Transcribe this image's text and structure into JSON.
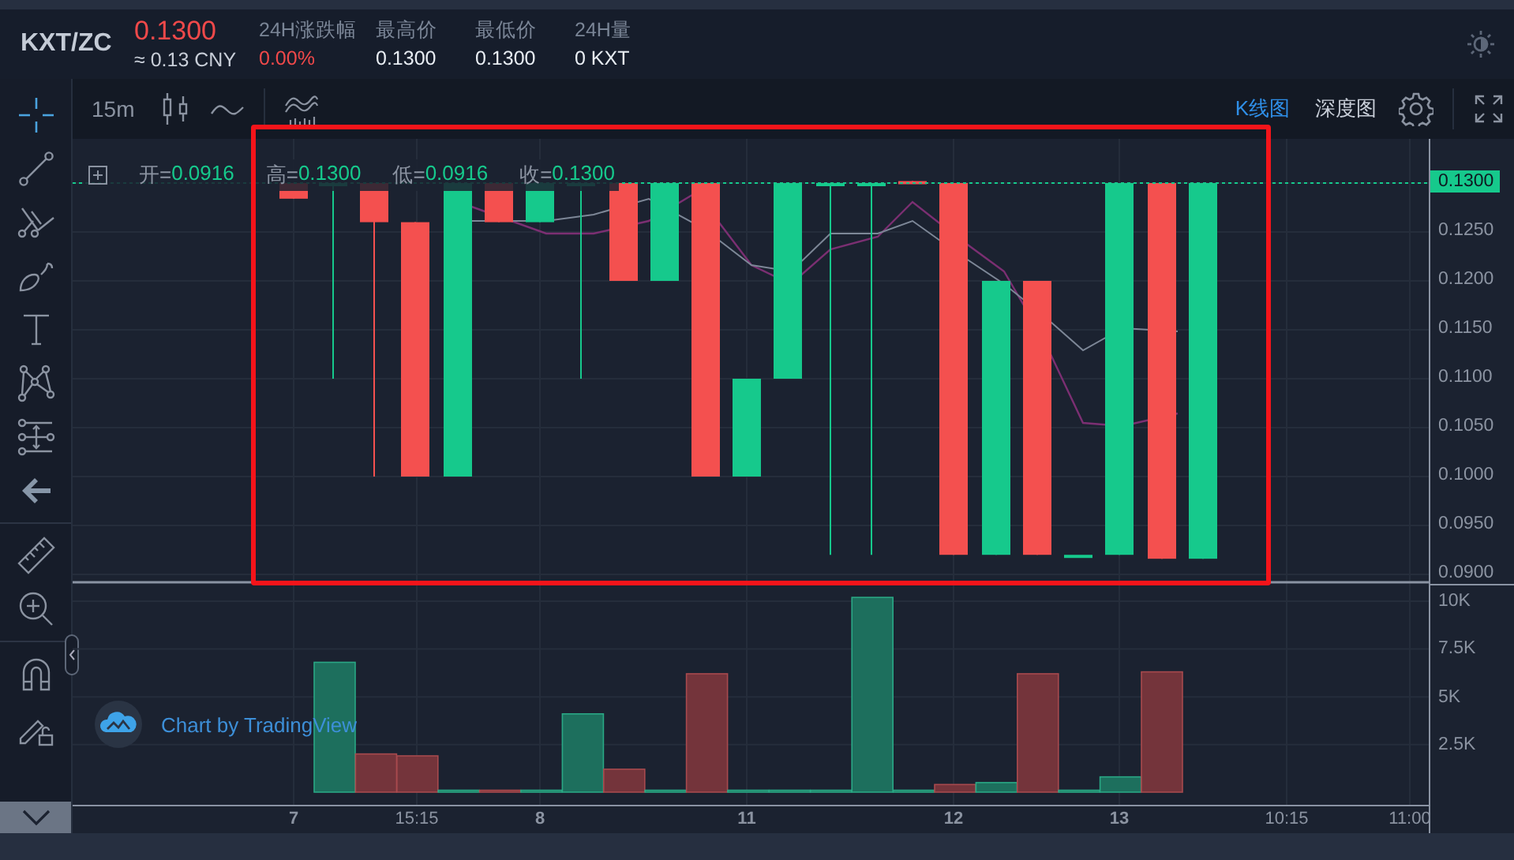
{
  "header": {
    "pair": "KXT/ZC",
    "price": "0.1300",
    "price_cny": "≈ 0.13 CNY",
    "stats": [
      {
        "label": "24H涨跌幅",
        "value": "0.00%",
        "kind": "change"
      },
      {
        "label": "最高价",
        "value": "0.1300",
        "kind": "plain"
      },
      {
        "label": "最低价",
        "value": "0.1300",
        "kind": "plain"
      },
      {
        "label": "24H量",
        "value": "0 KXT",
        "kind": "plain"
      }
    ]
  },
  "toolbar": {
    "interval": "15m",
    "views": [
      {
        "label": "K线图",
        "selected": true
      },
      {
        "label": "深度图",
        "selected": false
      }
    ]
  },
  "legend": [
    {
      "label": "开=",
      "value": "0.0916"
    },
    {
      "label": "高=",
      "value": "0.1300"
    },
    {
      "label": "低=",
      "value": "0.0916"
    },
    {
      "label": "收=",
      "value": "0.1300"
    }
  ],
  "price_axis": {
    "last_price": "0.1300",
    "ticks": [
      "0.1250",
      "0.1200",
      "0.1150",
      "0.1100",
      "0.1050",
      "0.1000",
      "0.0950",
      "0.0900"
    ]
  },
  "volume_axis": {
    "ticks": [
      "10K",
      "7.5K",
      "5K",
      "2.5K"
    ]
  },
  "time_axis": [
    {
      "label": "7",
      "kind": "day"
    },
    {
      "label": "15:15",
      "kind": "time"
    },
    {
      "label": "8",
      "kind": "day"
    },
    {
      "label": "11",
      "kind": "day"
    },
    {
      "label": "12",
      "kind": "day"
    },
    {
      "label": "13",
      "kind": "day"
    },
    {
      "label": "10:15",
      "kind": "time"
    },
    {
      "label": "11:00",
      "kind": "time"
    }
  ],
  "watermark_badge": {
    "text": "Chart by TradingView"
  }
}
